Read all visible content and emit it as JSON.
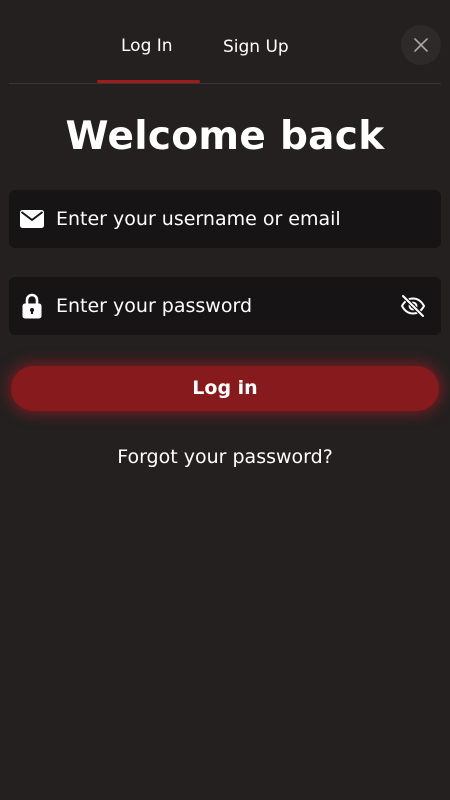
{
  "tabs": {
    "login_label": "Log In",
    "signup_label": "Sign Up",
    "active": "login"
  },
  "close_icon": "close-icon",
  "title": "Welcome back",
  "username_field": {
    "icon": "envelope-icon",
    "placeholder": "Enter your username or email",
    "value": ""
  },
  "password_field": {
    "icon": "lock-icon",
    "placeholder": "Enter your password",
    "value": "",
    "toggle_icon": "eye-slash-icon"
  },
  "login_button": {
    "label": "Log in"
  },
  "forgot_link": "Forgot your password?",
  "colors": {
    "background": "#242020",
    "field_background": "#161414",
    "accent": "#861a1d",
    "tab_underline": "#a11a1e"
  }
}
